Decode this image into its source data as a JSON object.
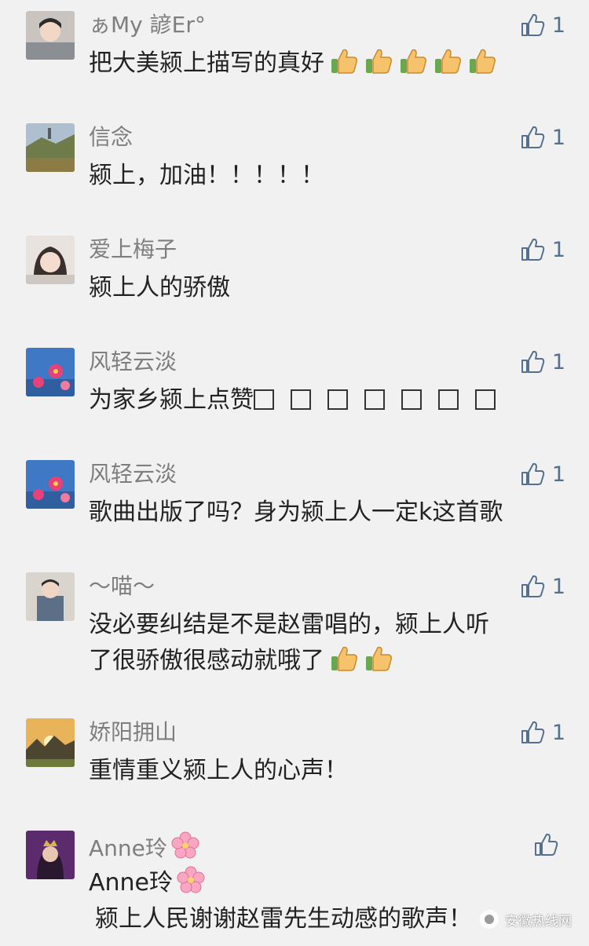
{
  "comments": [
    {
      "nickname": "ぁMy 諺Er°",
      "likes": "1",
      "text": "把大美颍上描写的真好",
      "trailing_emoji": [
        "thumbs-up",
        "thumbs-up",
        "thumbs-up",
        "thumbs-up",
        "thumbs-up"
      ]
    },
    {
      "nickname": "信念",
      "likes": "1",
      "text": "颍上，加油！！！！！"
    },
    {
      "nickname": "爱上梅子",
      "likes": "1",
      "text": "颍上人的骄傲"
    },
    {
      "nickname": "风轻云淡",
      "likes": "1",
      "text": "为家乡颍上点赞",
      "trailing_boxes": 7
    },
    {
      "nickname": "风轻云淡",
      "likes": "1",
      "text": "歌曲出版了吗？身为颍上人一定k这首歌"
    },
    {
      "nickname": "～喵～",
      "likes": "1",
      "text_line1": "没必要纠结是不是赵雷唱的，颍上人听",
      "text_line2": "了很骄傲很感动就哦了",
      "trailing_emoji": [
        "thumbs-up",
        "thumbs-up"
      ]
    },
    {
      "nickname": "娇阳拥山",
      "likes": "1",
      "text": "重情重义颍上人的心声！"
    },
    {
      "nickname": "Anne玲",
      "likes": "",
      "text_line1": "Anne玲",
      "text_line2": "颍上人民谢谢赵雷先生动感的歌声！",
      "nickname_emoji": "cherry-blossom"
    }
  ],
  "watermark": {
    "text": "安徽热线网"
  },
  "colors": {
    "background": "#f1f1f1",
    "like_icon": "#55708f",
    "nickname": "#7e7e7e",
    "text": "#222222"
  }
}
